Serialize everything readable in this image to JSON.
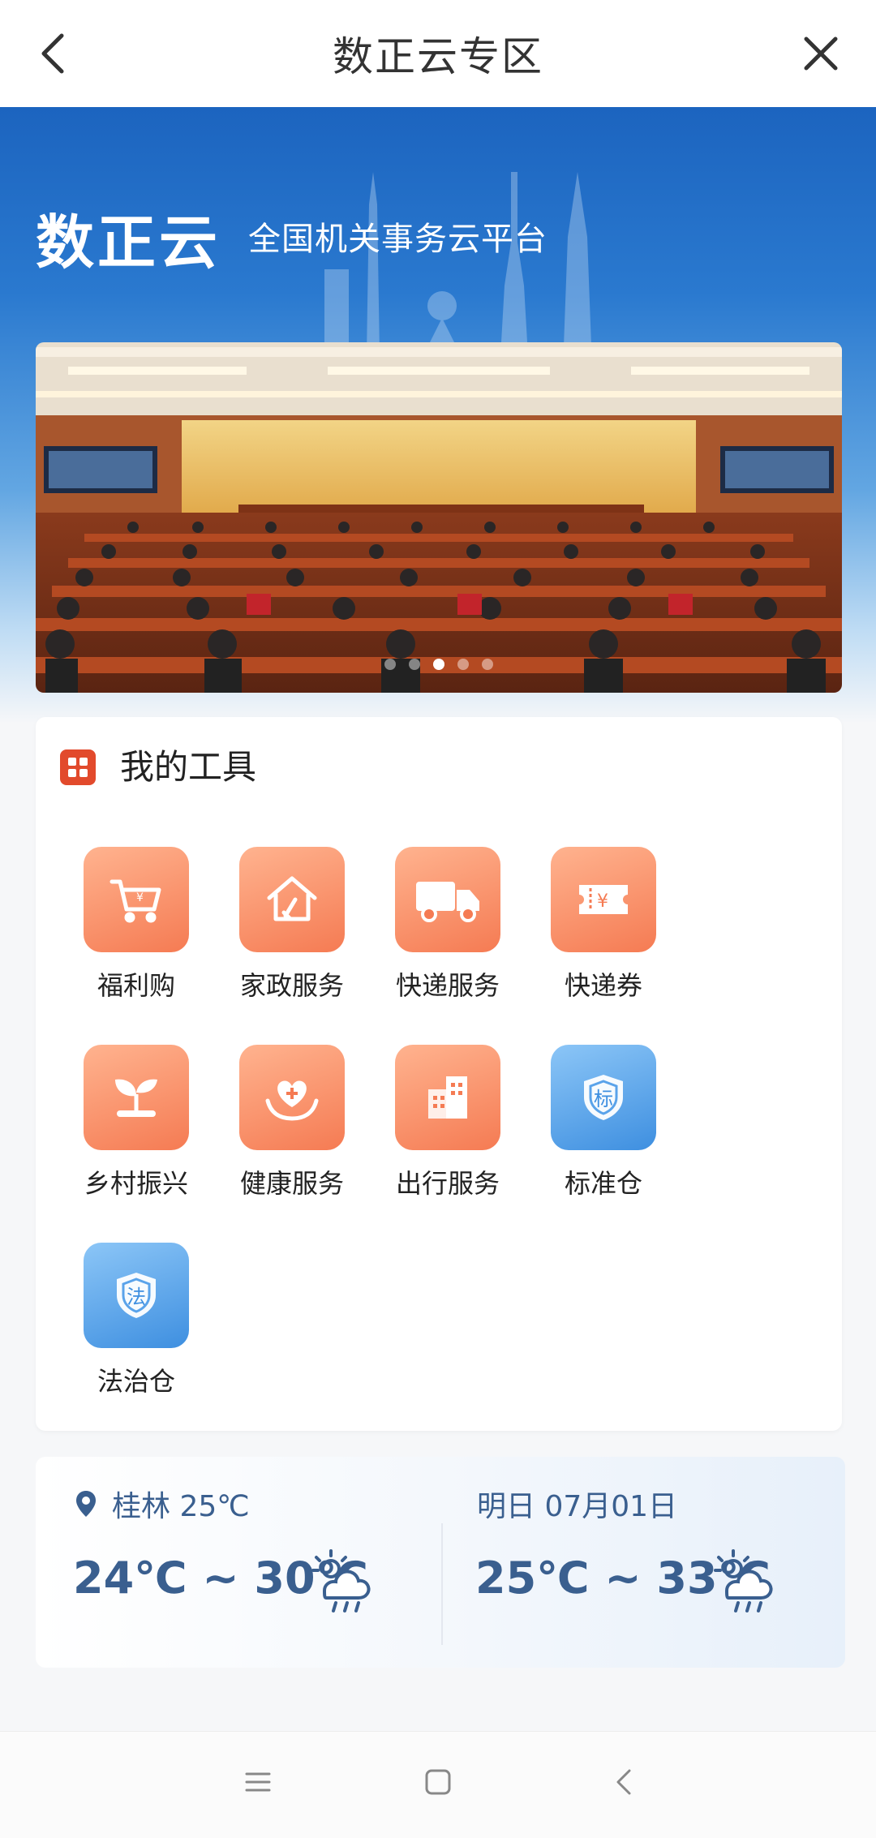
{
  "header": {
    "title": "数正云专区",
    "back_icon": "chevron-left-icon",
    "close_icon": "close-icon"
  },
  "hero": {
    "brand": "数正云",
    "slogan": "全国机关事务云平台",
    "banner_alt": "conference-hall-photo",
    "carousel": {
      "count": 5,
      "active_index": 2
    }
  },
  "tools": {
    "title": "我的工具",
    "items": [
      {
        "label": "福利购",
        "icon": "shopping-cart-icon",
        "color": "orange"
      },
      {
        "label": "家政服务",
        "icon": "home-cleaning-icon",
        "color": "orange"
      },
      {
        "label": "快递服务",
        "icon": "delivery-truck-icon",
        "color": "orange"
      },
      {
        "label": "快递券",
        "icon": "coupon-icon",
        "color": "orange"
      },
      {
        "label": "乡村振兴",
        "icon": "seedling-icon",
        "color": "orange"
      },
      {
        "label": "健康服务",
        "icon": "heart-hands-icon",
        "color": "orange"
      },
      {
        "label": "出行服务",
        "icon": "building-icon",
        "color": "orange"
      },
      {
        "label": "标准仓",
        "icon": "shield-biao-icon",
        "color": "blue",
        "glyph": "标"
      },
      {
        "label": "法治仓",
        "icon": "shield-fa-icon",
        "color": "blue",
        "glyph": "法"
      }
    ]
  },
  "weather": {
    "city_label": "桂林 25℃",
    "today_range": "24℃ ~ 30℃",
    "tomorrow_label": "明日 07月01日",
    "tomorrow_range": "25℃ ~ 33℃",
    "icon": "cloud-sun-rain-icon"
  },
  "system_nav": {
    "menu_icon": "menu-icon",
    "home_icon": "home-square-icon",
    "back_icon": "back-chevron-icon"
  },
  "colors": {
    "accent_orange": "#f57b53",
    "accent_blue": "#3e8fe0",
    "hero_blue": "#1c64bf",
    "weather_text": "#3a5f8f"
  }
}
